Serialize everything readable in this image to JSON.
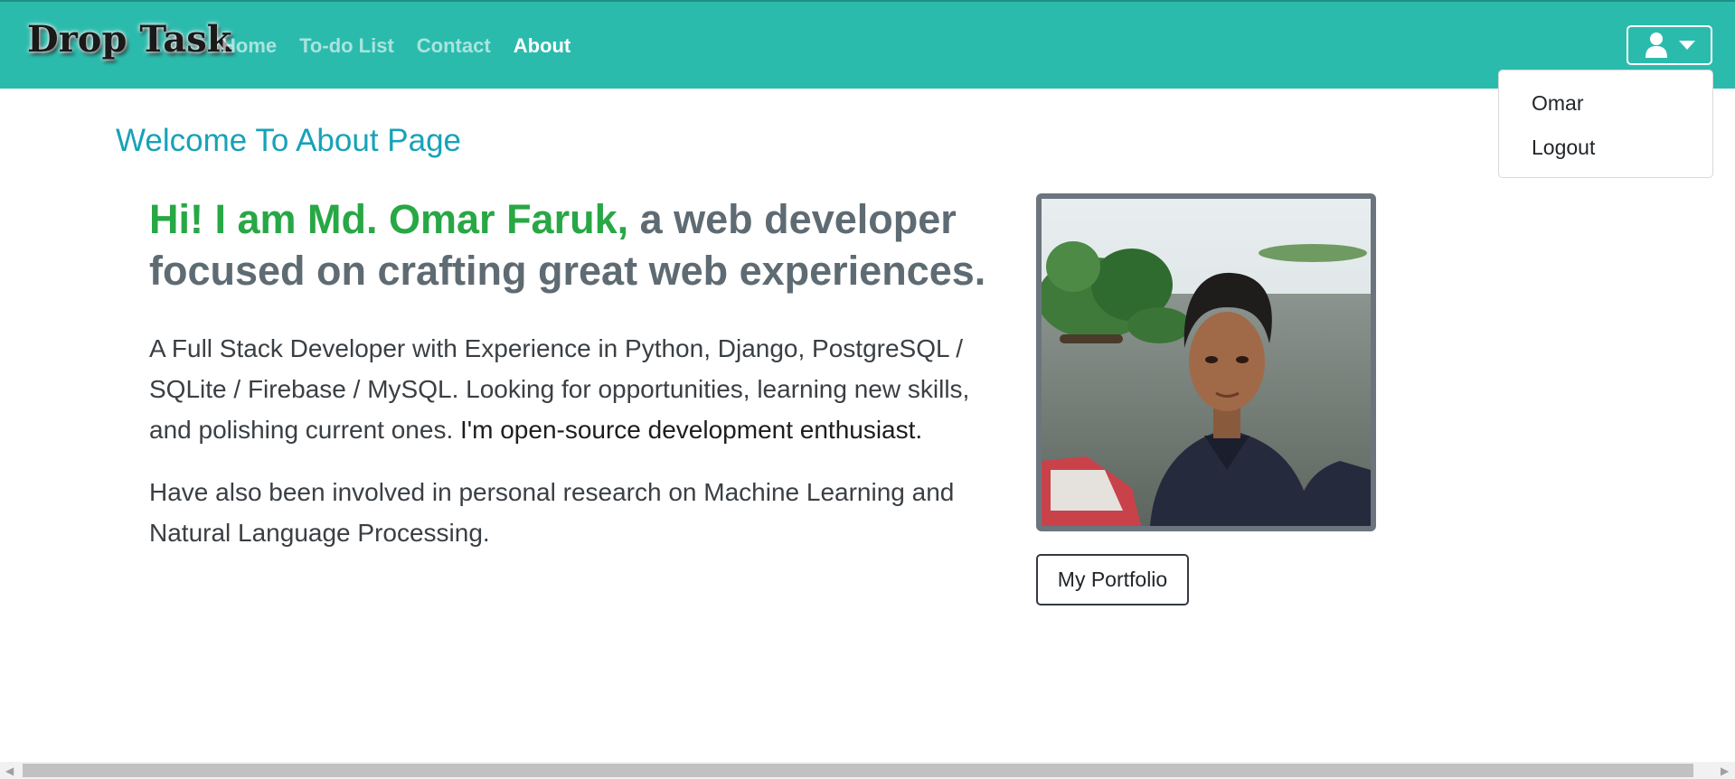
{
  "brand": {
    "logo_text": "Drop Task"
  },
  "nav": {
    "items": [
      {
        "label": "Home",
        "active": false
      },
      {
        "label": "To-do List",
        "active": false
      },
      {
        "label": "Contact",
        "active": false
      },
      {
        "label": "About",
        "active": true
      }
    ],
    "user_icon": "user-icon",
    "caret_icon": "caret-down-icon"
  },
  "dropdown": {
    "items": [
      "Omar",
      "Logout"
    ]
  },
  "main": {
    "title": "Welcome To About Page",
    "intro_name": "Hi! I am Md. Omar Faruk,",
    "intro_rest": " a web developer focused on crafting great web experiences.",
    "para1": "A Full Stack Developer with Experience in Python, Django, PostgreSQL / SQLite / Firebase / MySQL. Looking for opportunities, learning new skills, and polishing current ones.",
    "para1_emphasis": "I'm open-source development enthusiast.",
    "para2": "Have also been involved in personal research on Machine Learning and Natural Language Processing.",
    "portfolio_button": "My Portfolio"
  },
  "colors": {
    "navbar": "#2bbbad",
    "title": "#17a2b8",
    "name_accent": "#28a745",
    "heading_gray": "#5f6b73"
  }
}
